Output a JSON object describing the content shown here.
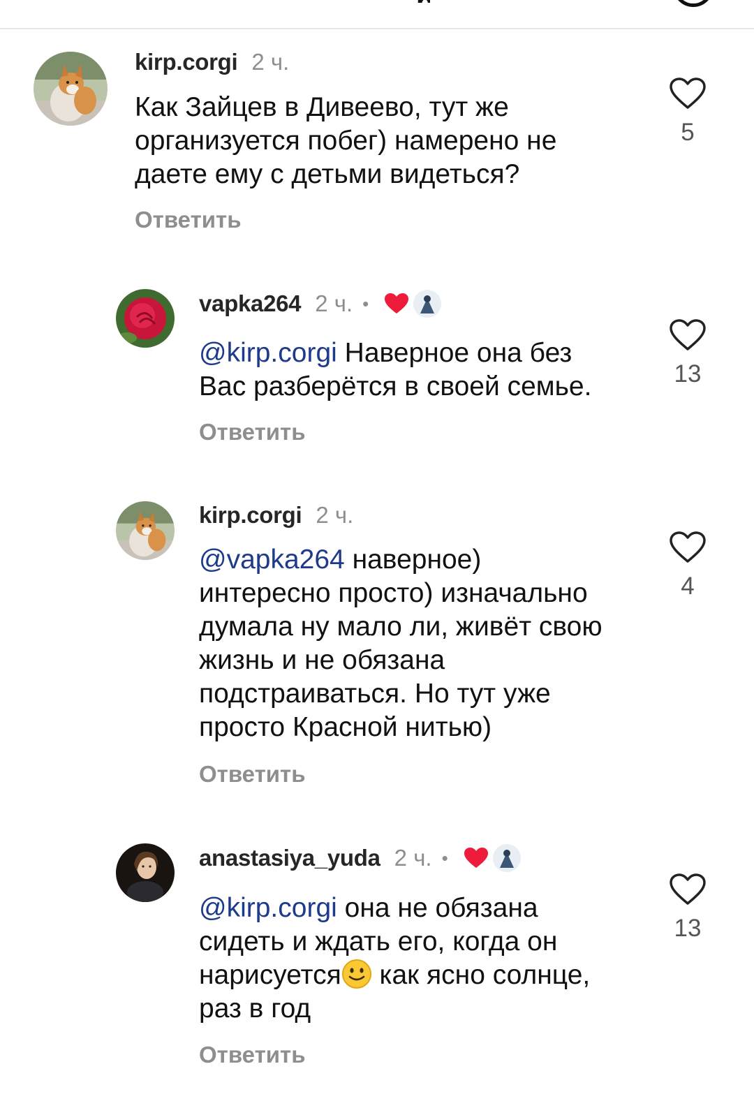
{
  "header": {
    "title_fragment": "р"
  },
  "comments": [
    {
      "username": "kirp.corgi",
      "time": "2 ч.",
      "text": "Как Зайцев в Дивеево, тут же организуется побег) намерено не даете ему с детьми видеться?",
      "text_lines": [
        "Как Зайцев в Дивеево, тут же",
        "организуется побег) намерено не",
        "даете ему с детьми видеться?"
      ],
      "mention": "",
      "likes": "5",
      "reply_label": "Ответить",
      "avatar_icon": "corgi-avatar",
      "liked_by_author": false
    },
    {
      "username": "vapka264",
      "time": "2 ч.",
      "dot": "•",
      "mention": "@kirp.corgi",
      "text_lines": [
        " Наверное она без",
        "Вас разберётся в своей семье."
      ],
      "likes": "13",
      "reply_label": "Ответить",
      "avatar_icon": "rose-avatar",
      "liked_by_author": true
    },
    {
      "username": "kirp.corgi",
      "time": "2 ч.",
      "mention": "@vapka264",
      "text_lines": [
        " наверное)",
        "интересно просто) изначально",
        "думала ну мало ли, живёт свою",
        "жизнь и не обязана",
        "подстраиваться. Но тут уже",
        "просто Красной нитью)"
      ],
      "likes": "4",
      "reply_label": "Ответить",
      "avatar_icon": "corgi-avatar",
      "liked_by_author": false
    },
    {
      "username": "anastasiya_yuda",
      "time": "2 ч.",
      "dot": "•",
      "mention": "@kirp.corgi",
      "text_lines": [
        " она не обязана",
        "сидеть и ждать его, когда он",
        "нарисуется",
        " как ясно солнце,",
        "раз в год"
      ],
      "likes": "13",
      "reply_label": "Ответить",
      "avatar_icon": "woman-avatar",
      "liked_by_author": true
    }
  ],
  "colors": {
    "mention": "#1d3b8a",
    "muted": "#8e8e8e",
    "heart_red": "#ed1c3b"
  }
}
